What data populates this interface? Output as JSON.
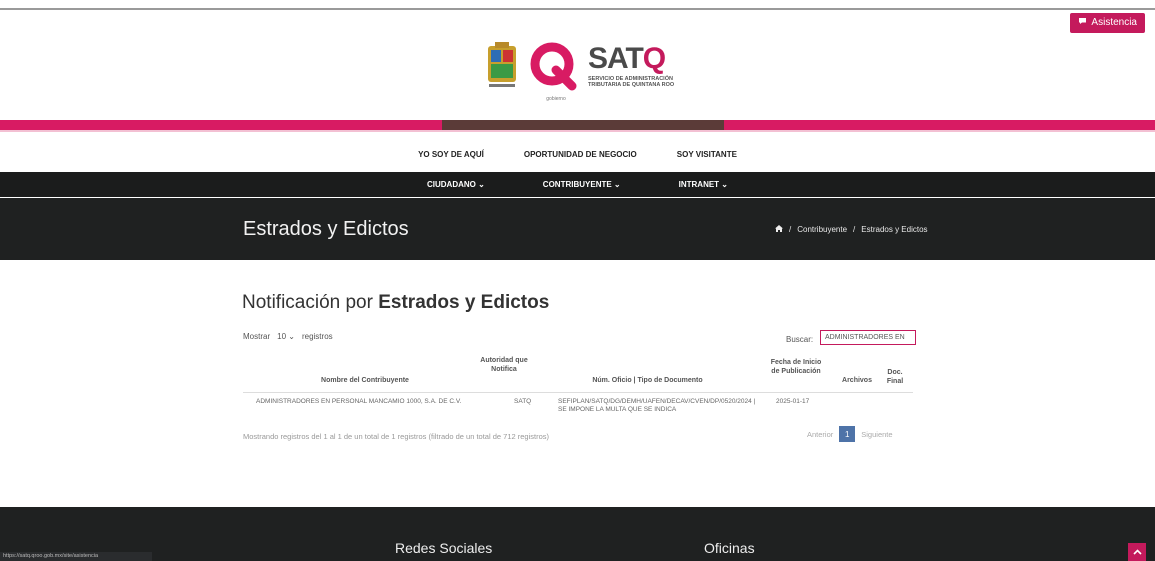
{
  "header": {
    "assist_label": "Asistencia",
    "sat_word": "SAT",
    "sat_letter": "Q",
    "sat_subtitle": "SERVICIO DE ADMINISTRACIÓN TRIBUTARIA DE QUINTANA ROO",
    "q_caption": "gobierno"
  },
  "sublinks": [
    "YO SOY DE AQUÍ",
    "OPORTUNIDAD DE NEGOCIO",
    "SOY VISITANTE"
  ],
  "mainnav": [
    "CIUDADANO ⌄",
    "CONTRIBUYENTE ⌄",
    "INTRANET ⌄"
  ],
  "title_band": {
    "title": "Estrados y Edictos",
    "breadcrumb_sep": "/",
    "crumb1": "Contribuyente",
    "crumb2": "Estrados y Edictos"
  },
  "section": {
    "heading_light": "Notificación por ",
    "heading_bold": "Estrados y Edictos",
    "show_label": "Mostrar",
    "show_value": "10",
    "show_suffix": "registros",
    "search_label": "Buscar:",
    "search_value": "ADMINISTRADORES EN"
  },
  "table": {
    "headers": {
      "contribuyente": "Nombre del Contribuyente",
      "autoridad": "Autoridad que Notifica",
      "oficio": "Núm. Oficio | Tipo de Documento",
      "fecha": "Fecha de Inicio de Publicación",
      "archivos": "Archivos",
      "doc_final": "Doc. Final"
    },
    "rows": [
      {
        "contribuyente": "ADMINISTRADORES EN PERSONAL MANCAMIO 1000, S.A. DE C.V.",
        "autoridad": "SATQ",
        "oficio": "SEFIPLAN/SATQ/DG/DEMH/UAFEN/DECAV/CVEN/DP/0520/2024 | SE IMPONE LA MULTA QUE SE INDICA",
        "fecha": "2025-01-17"
      }
    ]
  },
  "info": "Mostrando registros del 1 al 1 de un total de 1 registros (filtrado de un total de 712 registros)",
  "pager": {
    "prev": "Anterior",
    "current": "1",
    "next": "Siguiente"
  },
  "footer": {
    "social": "Redes Sociales",
    "offices": "Oficinas",
    "status_url": "https://satq.qroo.gob.mx/site/asistencia",
    "totop_icon": "chevron-up-icon"
  },
  "colors": {
    "brand": "#c41a5c",
    "dark": "#1f2121",
    "pager": "#4e73a8"
  }
}
